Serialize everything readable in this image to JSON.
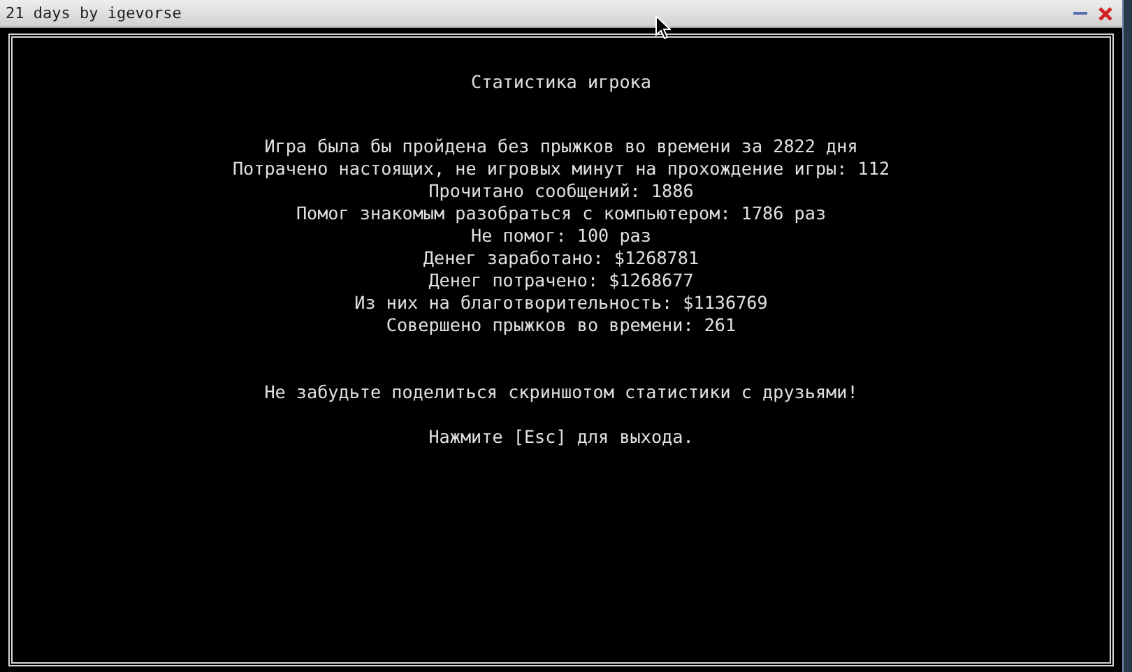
{
  "window": {
    "title": "21 days by igevorse"
  },
  "screen": {
    "heading": "Статистика игрока",
    "stats": [
      "Игра была бы пройдена без прыжков во времени за 2822 дня",
      "Потрачено настоящих, не игровых минут на прохождение игры: 112",
      "Прочитано сообщений: 1886",
      "Помог знакомым разобраться с компьютером: 1786 раз",
      "Не помог: 100 раз",
      "Денег заработано: $1268781",
      "Денег потрачено: $1268677",
      "Из них на благотворительность: $1136769",
      "Совершено прыжков во времени: 261"
    ],
    "share_note": "Не забудьте поделиться скриншотом статистики с друзьями!",
    "exit_hint": "Нажмите [Esc] для выхода."
  }
}
